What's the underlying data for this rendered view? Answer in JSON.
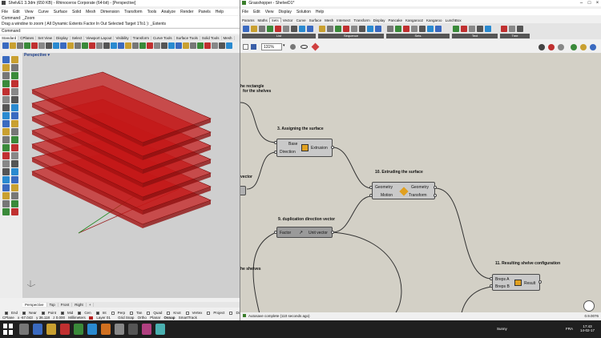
{
  "rhino": {
    "title": "ShelvE1 3.3dm (650 KB) - Rhinoceros Corporate (64-bit) - [Perspective]",
    "menu": [
      "File",
      "Edit",
      "View",
      "Curve",
      "Surface",
      "Solid",
      "Mesh",
      "Dimension",
      "Transform",
      "Tools",
      "Analyze",
      "Render",
      "Panels",
      "Help"
    ],
    "cmd_history_1": "Command: _Zoom",
    "cmd_history_2": "Drag a window to zoom ( All  Dynamic  Extents  Factor  In  Out  Selected  Target  1To1 ): _Extents",
    "command_label": "Command:",
    "tabs": [
      "Standard",
      "CPlanes",
      "Set View",
      "Display",
      "Select",
      "Viewport Layout",
      "Visibility",
      "Transform",
      "Curve Tools",
      "Surface Tools",
      "Solid Tools",
      "Mesh"
    ],
    "viewport_label": "Perspective",
    "view_tabs": [
      "Perspective",
      "Top",
      "Front",
      "Right",
      "+"
    ],
    "osnaps": [
      {
        "label": "End",
        "on": true
      },
      {
        "label": "Near",
        "on": true
      },
      {
        "label": "Point",
        "on": true
      },
      {
        "label": "Mid",
        "on": true
      },
      {
        "label": "Cen",
        "on": true
      },
      {
        "label": "Int",
        "on": true
      },
      {
        "label": "Perp",
        "on": false
      },
      {
        "label": "Tan",
        "on": false
      },
      {
        "label": "Quad",
        "on": false
      },
      {
        "label": "Knot",
        "on": false
      },
      {
        "label": "Vertex",
        "on": false
      },
      {
        "label": "Project",
        "on": false
      },
      {
        "label": "Disable",
        "on": false
      }
    ],
    "status": {
      "cplane": "CPlane",
      "x": "x -67.043",
      "y": "y 36.118",
      "z": "z 0.000",
      "units": "Millimeters",
      "layer": "Layer 01",
      "grid_snap": "Grid Snap",
      "ortho": "Ortho",
      "planar": "Planar",
      "osnap": "Osnap",
      "smarttrack": "SmartTrack"
    },
    "layer_color": "#b42020"
  },
  "gh": {
    "title": "Grasshopper - ShelveD1*",
    "menu": [
      "File",
      "Edit",
      "View",
      "Display",
      "Solution",
      "Help"
    ],
    "tabs": [
      "Params",
      "Maths",
      "Sets",
      "Vector",
      "Curve",
      "Surface",
      "Mesh",
      "Intersect",
      "Transform",
      "Display",
      "Pancake",
      "Kangaroo2",
      "Kangaroo",
      "LunchBox"
    ],
    "active_tab": "Sets",
    "groups": [
      "List",
      "Sequence",
      "Sets",
      "Text",
      "Tree"
    ],
    "zoom": "131%",
    "annotations": {
      "a1": "he rectangle",
      "a2": "for the shelves",
      "a3": "3. Assigning the surface",
      "a4": "vector",
      "a5": "10. Extruding the surface",
      "a6": "9. duplication direction vector",
      "a7": "he shelves",
      "a8": "11.  Resulting shelve configuration"
    },
    "extrusion": {
      "in1": "Base",
      "in2": "Direction",
      "name": "Extrusion"
    },
    "move": {
      "in1": "Geometry",
      "in2": "Motion",
      "out1": "Geometry",
      "out2": "Transform"
    },
    "unitvec": {
      "in1": "Factor",
      "out1": "Unit vector"
    },
    "result": {
      "in1": "Breps A",
      "in2": "Breps B",
      "out1": "Result"
    },
    "status": "Autosave complete (110 seconds ago)",
    "version": "0.9.0076"
  },
  "taskbar": {
    "weather": "Sunny",
    "lang": "FRA",
    "time": "17:43",
    "date": "14-02-17"
  }
}
